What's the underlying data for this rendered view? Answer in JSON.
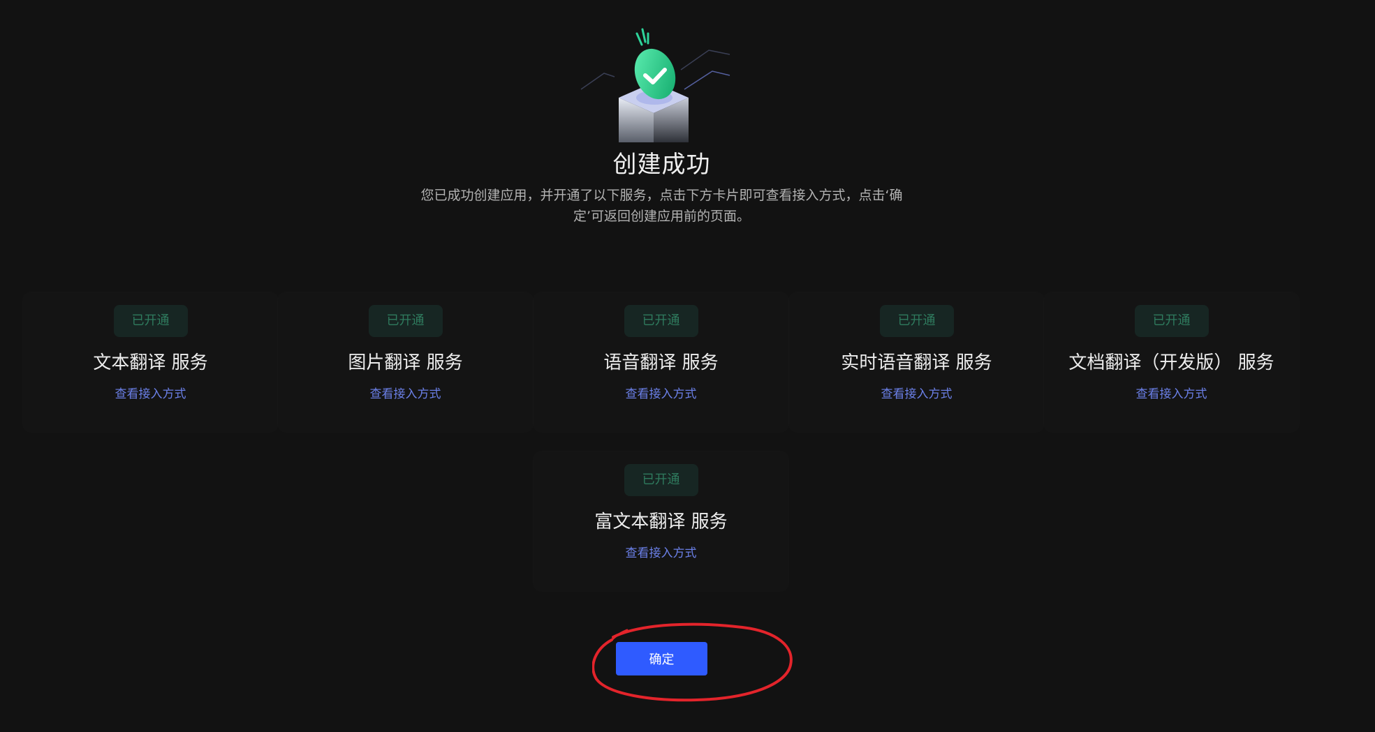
{
  "illustration": {
    "icon": "success-check-box-illustration",
    "accent": "#22c080"
  },
  "header": {
    "title": "创建成功",
    "description": "您已成功创建应用，并开通了以下服务，点击下方卡片即可查看接入方式，点击‘确定’可返回创建应用前的页面。"
  },
  "services": [
    {
      "badge": "已开通",
      "title": "文本翻译 服务",
      "link": "查看接入方式"
    },
    {
      "badge": "已开通",
      "title": "图片翻译 服务",
      "link": "查看接入方式"
    },
    {
      "badge": "已开通",
      "title": "语音翻译 服务",
      "link": "查看接入方式"
    },
    {
      "badge": "已开通",
      "title": "实时语音翻译 服务",
      "link": "查看接入方式"
    },
    {
      "badge": "已开通",
      "title": "文档翻译（开发版） 服务",
      "link": "查看接入方式"
    },
    {
      "badge": "已开通",
      "title": "富文本翻译 服务",
      "link": "查看接入方式"
    }
  ],
  "actions": {
    "confirm_label": "确定"
  },
  "colors": {
    "background": "#121212",
    "badge_text": "#2f7b5e",
    "link": "#6b80e8",
    "primary_button": "#2f5bff",
    "annotation": "#e3242b"
  }
}
